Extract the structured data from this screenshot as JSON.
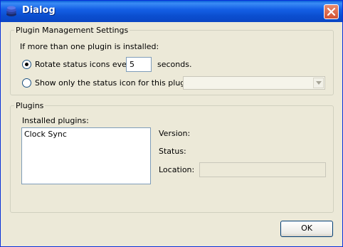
{
  "window": {
    "title": "Dialog"
  },
  "management_group": {
    "legend": "Plugin Management Settings",
    "intro": "If more than one plugin is installed:",
    "rotate_option": {
      "label": "Rotate status icons every",
      "checked": true
    },
    "rotate_interval": {
      "value": "5"
    },
    "rotate_suffix": "seconds.",
    "single_option": {
      "label": "Show only the status icon for this plugin:",
      "checked": false
    },
    "plugin_select": {
      "value": ""
    }
  },
  "plugins_group": {
    "legend": "Plugins",
    "installed_label": "Installed plugins:",
    "installed_items": [
      "Clock Sync"
    ],
    "version_label": "Version:",
    "status_label": "Status:",
    "location_label": "Location:",
    "location_value": ""
  },
  "footer": {
    "ok_label": "OK"
  }
}
